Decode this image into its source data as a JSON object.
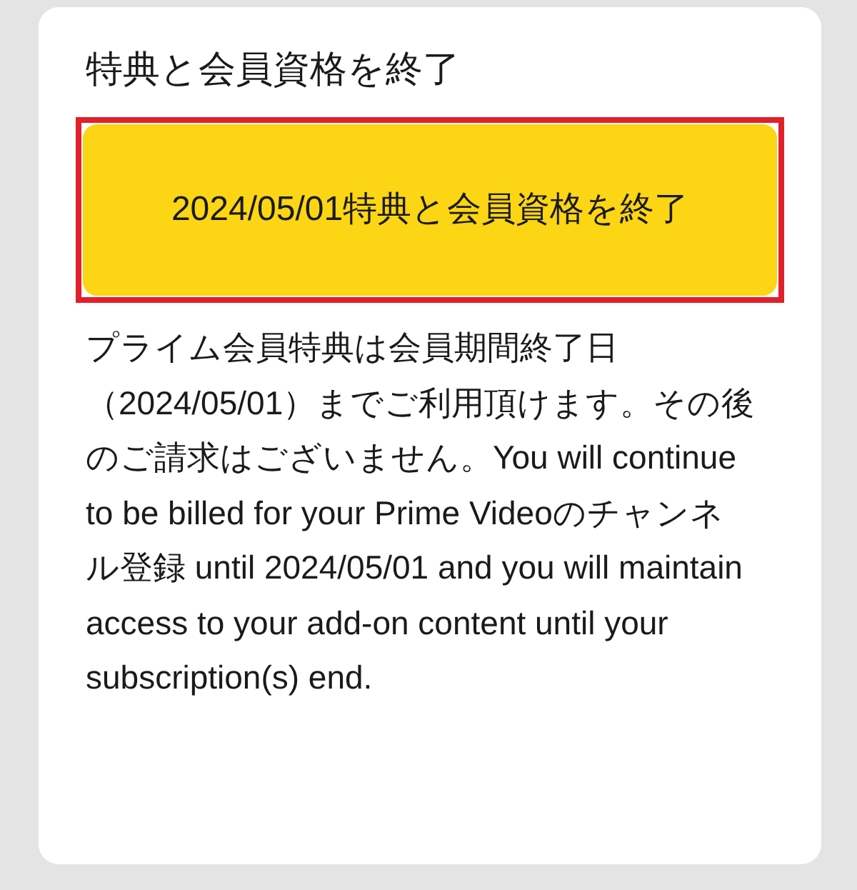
{
  "dialog": {
    "title": "特典と会員資格を終了",
    "button": {
      "label": "2024/05/01特典と会員資格を終了",
      "highlighted": true
    },
    "message": "プライム会員特典は会員期間終了日（2024/05/01）までご利用頂けます。その後のご請求はございません。You will continue to be billed for your Prime Videoのチャンネル登録 until 2024/05/01 and you will maintain access to your add-on content until your subscription(s) end."
  }
}
